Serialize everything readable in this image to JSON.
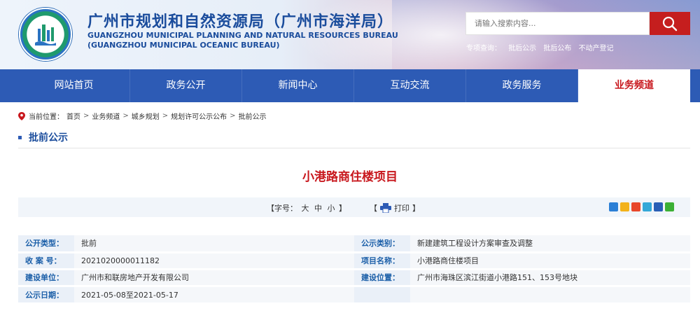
{
  "header": {
    "title_cn": "广州市规划和自然资源局（广州市海洋局）",
    "title_en_line1": "GUANGZHOU MUNICIPAL PLANNING AND NATURAL RESOURCES BUREAU",
    "title_en_line2": "(GUANGZHOU MUNICIPAL OCEANIC BUREAU)",
    "search_placeholder": "请输入搜索内容...",
    "special_label": "专项查询：",
    "special_links": [
      "批后公示",
      "批后公布",
      "不动产登记"
    ]
  },
  "nav": {
    "items": [
      "网站首页",
      "政务公开",
      "新闻中心",
      "互动交流",
      "政务服务",
      "业务频道"
    ],
    "active_index": 5
  },
  "breadcrumb": {
    "prefix": "当前位置：",
    "items": [
      "首页",
      "业务频道",
      "城乡规划",
      "规划许可公示公布",
      "批前公示"
    ],
    "separator": ">"
  },
  "section": {
    "title": "批前公示"
  },
  "article": {
    "title": "小港路商住楼项目"
  },
  "toolbar": {
    "font_label": "【字号：",
    "font_large": "大",
    "font_medium": "中",
    "font_small": "小",
    "font_close": "】",
    "print_open": "【",
    "print_label": "打印",
    "print_close": "】"
  },
  "colors": {
    "nav_bg": "#2d5bb5",
    "accent_red": "#c8171d",
    "label_blue": "#1a5ea8"
  },
  "info": {
    "row1": {
      "label1": "公开类型：",
      "value1": "批前",
      "label2": "公示类别：",
      "value2": "新建建筑工程设计方案审查及调整"
    },
    "row2": {
      "label1": "收 案 号：",
      "value1": "2021020000011182",
      "label2": "项目名称：",
      "value2": "小港路商住楼项目"
    },
    "row3": {
      "label1": "建设单位：",
      "value1": "广州市和联房地产开发有限公司",
      "label2": "建设位置：",
      "value2": "广州市海珠区滨江街道小港路151、153号地块"
    },
    "row4": {
      "label1": "公示日期：",
      "value1": "2021-05-08至2021-05-17",
      "label2": "",
      "value2": ""
    }
  }
}
